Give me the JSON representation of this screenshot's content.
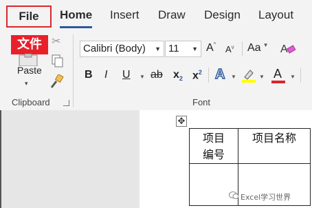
{
  "tabs": {
    "file": "File",
    "home": "Home",
    "insert": "Insert",
    "draw": "Draw",
    "design": "Design",
    "layout": "Layout"
  },
  "annotation": {
    "file_chinese": "文件"
  },
  "clipboard": {
    "paste_label": "Paste",
    "group_label": "Clipboard"
  },
  "font": {
    "family": "Calibri (Body)",
    "size": "11",
    "group_label": "Font",
    "bold": "B",
    "italic": "I",
    "underline": "U",
    "strikethrough": "ab",
    "subscript": "x",
    "subscript_mark": "2",
    "superscript": "x",
    "superscript_mark": "2",
    "change_case": "Aa",
    "text_effects": "A",
    "font_color": "A",
    "grow_font": "A",
    "shrink_font": "A"
  },
  "colors": {
    "highlight": "#ffff00",
    "font_color": "#d9262b",
    "accent": "#2b579a",
    "file_box": "#d9262b"
  },
  "document": {
    "table": [
      [
        "项目\n编号",
        "项目名称"
      ],
      [
        "",
        ""
      ]
    ],
    "watermark": "Excel学习世界"
  }
}
